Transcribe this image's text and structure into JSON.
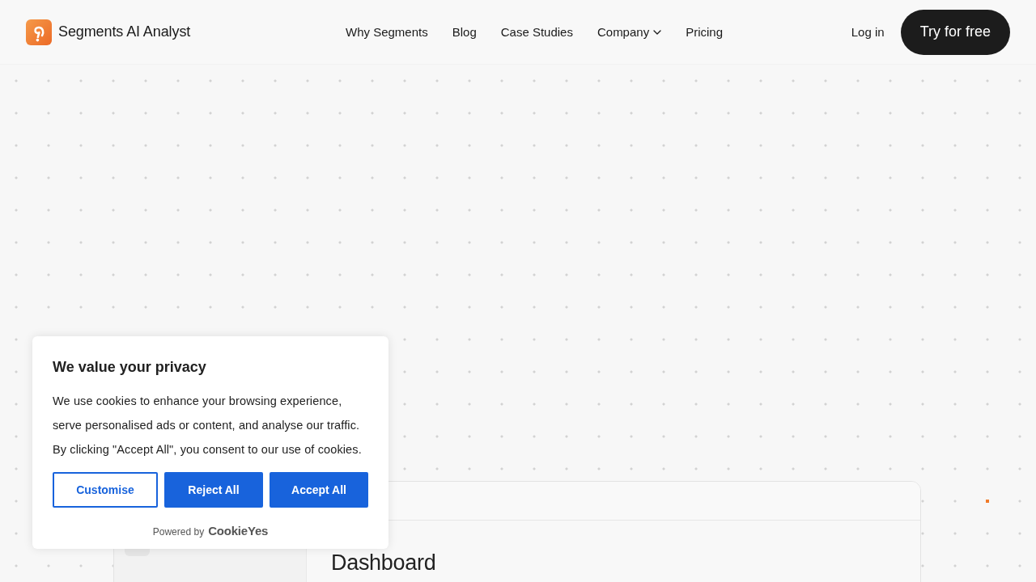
{
  "header": {
    "brand": "Segments AI Analyst",
    "nav": [
      {
        "label": "Why Segments",
        "kind": "link"
      },
      {
        "label": "Blog",
        "kind": "link"
      },
      {
        "label": "Case Studies",
        "kind": "link"
      },
      {
        "label": "Company",
        "kind": "dropdown"
      },
      {
        "label": "Pricing",
        "kind": "link"
      }
    ],
    "login": "Log in",
    "cta": "Try for free"
  },
  "preview": {
    "title": "Dashboard"
  },
  "cookie_banner": {
    "title": "We value your privacy",
    "body": "We use cookies to enhance your browsing experience, serve personalised ads or content, and analyse our traffic. By clicking \"Accept All\", you consent to our use of cookies.",
    "buttons": [
      {
        "label": "Customise",
        "kind": "outline"
      },
      {
        "label": "Reject All",
        "kind": "solid"
      },
      {
        "label": "Accept All",
        "kind": "solid"
      }
    ],
    "powered_by": "Powered by",
    "brand": "CookieYes"
  }
}
